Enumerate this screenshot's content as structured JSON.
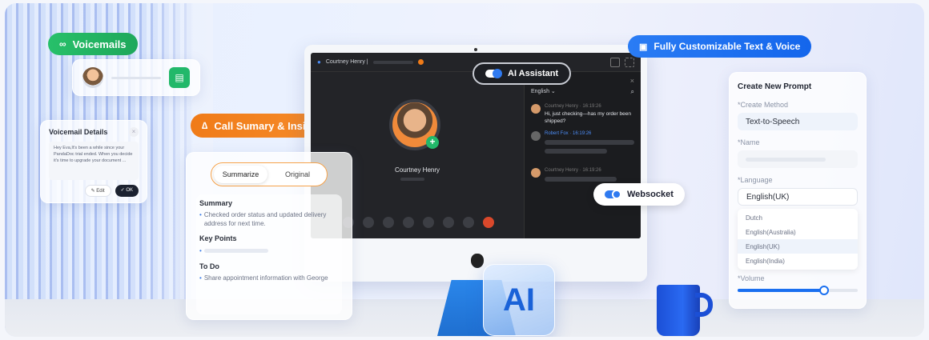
{
  "voicemails": {
    "label": "Voicemails"
  },
  "voicemail_details": {
    "title": "Voicemail Details",
    "close": "×",
    "message": "Hey Eva,It's been a while since your PandaDoc trial ended. When you decide it's time to upgrade your document ...",
    "edit_label": "✎ Edit",
    "ok_label": "✓ OK"
  },
  "call_summary": {
    "label": "Call Sumary & Insight"
  },
  "summary_card": {
    "tabs": [
      "Summarize",
      "Original"
    ],
    "summary_heading": "Summary",
    "summary_text": "Checked order status and updated delivery address for next time.",
    "key_points_heading": "Key Points",
    "todo_heading": "To Do",
    "todo_text": "Share appointment information with George"
  },
  "call": {
    "caller_bar": "Courtney Henry |",
    "caller_name": "Courtney Henry",
    "language": "English",
    "messages": [
      {
        "sender": "Courtney Henry",
        "time": "16:19:26",
        "text": "Hi, just checking—has my order been shipped?"
      },
      {
        "sender": "Robert Fox",
        "time": "16:19:26",
        "text": ""
      },
      {
        "sender": "Courtney Henry",
        "time": "16:19:26",
        "text": ""
      }
    ]
  },
  "ai_assistant": {
    "label": "AI Assistant"
  },
  "websocket": {
    "label": "Websocket"
  },
  "ai_badge": {
    "label": "AI"
  },
  "customizable": {
    "label": "Fully Customizable Text & Voice"
  },
  "prompt_card": {
    "title": "Create New Prompt",
    "method_label": "*Create Method",
    "method_value": "Text-to-Speech",
    "name_label": "*Name",
    "language_label": "*Language",
    "language_value": "English(UK)",
    "options": [
      "Dutch",
      "English(Australia)",
      "English(UK)",
      "English(India)"
    ],
    "volume_label": "*Volume",
    "volume_level": 0.72
  },
  "colors": {
    "green": "#22b86a",
    "orange": "#f5801e",
    "blue": "#1a6ff0"
  }
}
